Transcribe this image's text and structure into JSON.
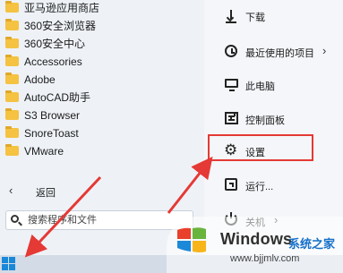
{
  "app_list": [
    {
      "label": "亚马逊应用商店"
    },
    {
      "label": "360安全浏览器"
    },
    {
      "label": "360安全中心"
    },
    {
      "label": "Accessories"
    },
    {
      "label": "Adobe"
    },
    {
      "label": "AutoCAD助手"
    },
    {
      "label": "S3 Browser"
    },
    {
      "label": "SnoreToast"
    },
    {
      "label": "VMware"
    }
  ],
  "back": {
    "chevron": "‹",
    "label": "返回"
  },
  "search": {
    "placeholder": "搜索程序和文件"
  },
  "right_menu": {
    "download": "下载",
    "recent": "最近使用的项目",
    "recent_chevron": "›",
    "computer": "此电脑",
    "control_panel": "控制面板",
    "settings": "设置",
    "run": "运行...",
    "power": "关机",
    "power_chevron": "›"
  },
  "watermark": {
    "brand": "Windows",
    "cn": "系统之家",
    "url": "www.bjjmlv.com"
  },
  "colors": {
    "highlight": "#e53935",
    "arrow": "#e53935",
    "start_tile": "#1a88d8",
    "folder": "#f5c242"
  }
}
